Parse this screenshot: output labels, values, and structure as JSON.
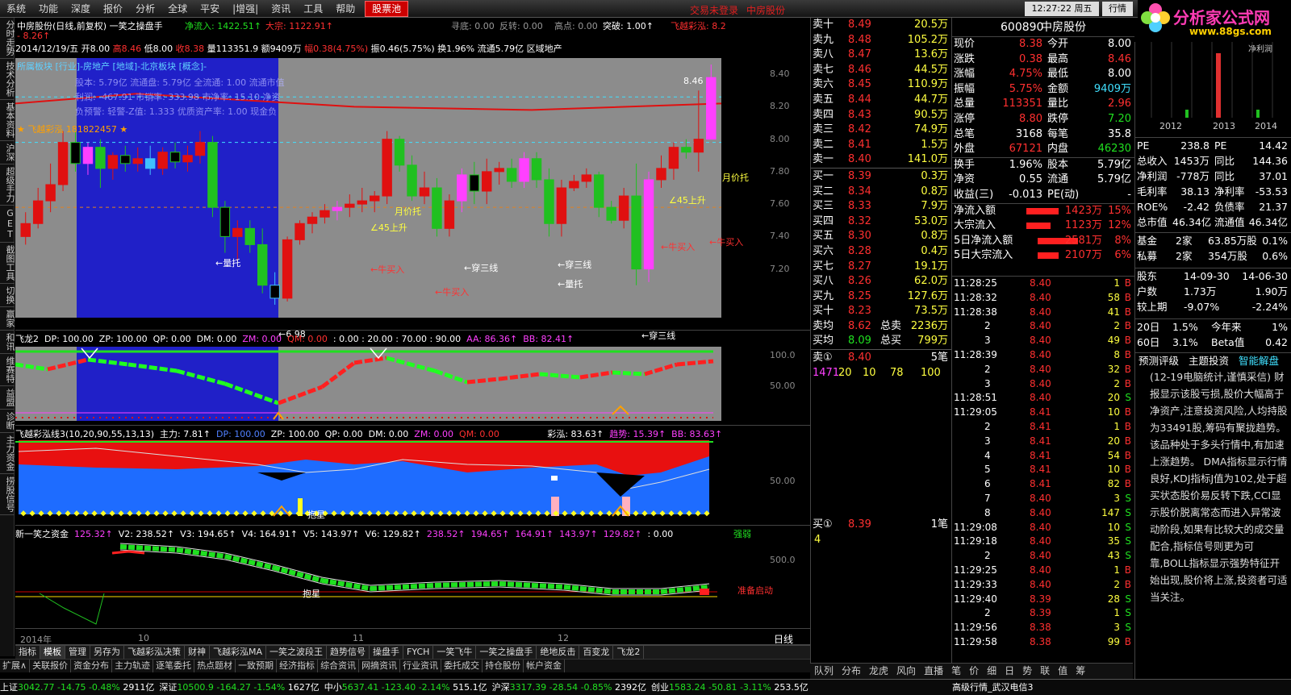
{
  "menu": {
    "items": [
      "系统",
      "功能",
      "深度",
      "报价",
      "分析",
      "全球",
      "平安",
      "|增强|",
      "资讯",
      "工具",
      "帮助"
    ],
    "highlight": "股票池",
    "login": "交易未登录",
    "stock_link": "中房股份",
    "time": "12:27:22 周五",
    "quote_btn": "行情"
  },
  "logo": {
    "text": "分析家公式网",
    "url": "www.88gs.com"
  },
  "vtabs": [
    "分时走势",
    "技术分析",
    "基本资料",
    "沪深",
    "超级手力",
    "GET",
    "截图工具",
    "切换",
    "赢家",
    "和讯",
    "维赛特",
    "益盟",
    "诊断",
    "主力资金",
    "捞股信号"
  ],
  "main": {
    "title": "中房股份(日线,前复权) 一笑之操盘手",
    "net_in": "净流入: 1422.51↑",
    "big": "大宗: 1122.91↑",
    "find_top": "寻底: 0.00",
    "reversal": "反转: 0.00",
    "high_pt": "高点: 0.00",
    "break": "突破: 1.00↑",
    "colorful": "飞越彩泓: 8.2",
    "line2_a": "2014/12/19/五",
    "open": "开8.00",
    "high": "高8.46",
    "low": "低8.00",
    "close": "收8.38",
    "vol": "量113351.9",
    "amt": "额9409万",
    "rng": "幅0.38(4.75%)",
    "amp": "振0.46(5.75%)",
    "turn": "换1.96%",
    "flow": "流通5.79亿",
    "region": "区域地产",
    "change": "- 8.26↑",
    "sector": "所属板块 [行业]-房地产 [地域]-北京板块 [概念]-",
    "info1": "股本: 5.79亿 流通盘: 5.79亿 全流通: 1.00 流通市值",
    "info2": "利润: -467.91 市销率: 333.98 市净率: 15.10 净资",
    "info3": "负预警: 轻警-Z值: 1.333 优质资产率: 1.00 现金负",
    "star": "★ 飞越彩泓 181822457 ★",
    "yticks": [
      "8.40",
      "8.20",
      "8.00",
      "7.80",
      "7.60",
      "7.40",
      "7.20"
    ],
    "labels": [
      "←量托",
      "←牛买入",
      "←牛买入",
      "←穿三线",
      "←量托",
      "←穿三线",
      "月价托",
      "∠45上升",
      "月价托",
      "∠45上升",
      "←牛买入",
      "←牛买入",
      "←穿三线",
      "8.46",
      "←6.98"
    ]
  },
  "p2": {
    "name": "飞龙2",
    "dp": "DP: 100.00",
    "zp": "ZP: 100.00",
    "qp": "QP: 0.00",
    "dm": "DM: 0.00",
    "zm": "ZM: 0.00",
    "qm": "QM: 0.00",
    "levels": ": 0.00 : 20.00 : 70.00 : 90.00",
    "aa": "AA: 86.36↑",
    "bb": "BB: 82.41↑",
    "yticks": [
      "100.0",
      "50.00"
    ]
  },
  "p3": {
    "name": "飞越彩泓线3(10,20,90,55,13,13)",
    "main": "主力: 7.81↑",
    "dp": "DP: 100.00",
    "zp": "ZP: 100.00",
    "qp": "QP: 0.00",
    "dm": "DM: 0.00",
    "zm": "ZM: 0.00",
    "qm": "QM: 0.00",
    "cai": "彩泓: 83.63↑",
    "trend": "趋势: 15.39↑",
    "bb": "BB: 83.63↑",
    "ytick": "50.00",
    "hold": "抱星"
  },
  "p4": {
    "name": "新一笑之资金",
    "v1": "125.32↑",
    "v2": "V2: 238.52↑",
    "v3": "V3: 194.65↑",
    "v4": "V4: 164.91↑",
    "v5": "V5: 143.97↑",
    "v6": "V6: 129.82↑",
    "r1": "238.52↑",
    "r2": "194.65↑",
    "r3": "164.91↑",
    "r4": "143.97↑",
    "r5": "129.82↑",
    "r6": ": 0.00",
    "strong": "强弱",
    "ytick": "500.0",
    "hold": "抱星",
    "ready": "准备启动"
  },
  "xaxis": [
    "2014年",
    "10",
    "11",
    "12"
  ],
  "btabs": [
    "指标",
    "模板",
    "管理",
    "另存为",
    "飞越彩泓决策",
    "财神",
    "飞越彩泓MA",
    "一笑之波段王",
    "趋势信号",
    "操盘手",
    "FYCH",
    "一笑飞牛",
    "一笑之操盘手",
    "绝地反击",
    "百变龙",
    "飞龙2"
  ],
  "btabs_active": "模板",
  "btabs2": [
    "扩展∧",
    "关联报价",
    "资金分布",
    "主力轨迹",
    "逐笔委托",
    "热点题材",
    "一致预期",
    "经济指标",
    "综合资讯",
    "网摘资讯",
    "行业资讯",
    "委托成交",
    "持仓股份",
    "帐户资金"
  ],
  "daytab": "日线",
  "book": {
    "sell": [
      [
        "卖十",
        "8.49",
        "20.5万"
      ],
      [
        "卖九",
        "8.48",
        "105.2万"
      ],
      [
        "卖八",
        "8.47",
        "13.6万"
      ],
      [
        "卖七",
        "8.46",
        "44.5万"
      ],
      [
        "卖六",
        "8.45",
        "110.9万"
      ],
      [
        "卖五",
        "8.44",
        "44.7万"
      ],
      [
        "卖四",
        "8.43",
        "90.5万"
      ],
      [
        "卖三",
        "8.42",
        "74.9万"
      ],
      [
        "卖二",
        "8.41",
        "1.5万"
      ],
      [
        "卖一",
        "8.40",
        "141.0万"
      ]
    ],
    "buy": [
      [
        "买一",
        "8.39",
        "0.3万"
      ],
      [
        "买二",
        "8.34",
        "0.8万"
      ],
      [
        "买三",
        "8.33",
        "7.9万"
      ],
      [
        "买四",
        "8.32",
        "53.0万"
      ],
      [
        "买五",
        "8.30",
        "0.8万"
      ],
      [
        "买六",
        "8.28",
        "0.4万"
      ],
      [
        "买七",
        "8.27",
        "19.1万"
      ],
      [
        "买八",
        "8.26",
        "62.0万"
      ],
      [
        "买九",
        "8.25",
        "127.6万"
      ],
      [
        "买十",
        "8.23",
        "73.5万"
      ]
    ],
    "avg_sell": [
      "卖均",
      "8.62",
      "总卖",
      "2236万"
    ],
    "avg_buy": [
      "买均",
      "8.09",
      "总买",
      "799万"
    ],
    "s1": [
      "卖①",
      "8.40",
      "5笔"
    ],
    "s1q": [
      "1471",
      "20",
      "10",
      "78",
      "100"
    ],
    "b1": [
      "买①",
      "8.39",
      "1笔"
    ],
    "b1q": "4"
  },
  "quote": {
    "code": "600890",
    "name": "中房股份",
    "rows": [
      [
        "现价",
        "8.38",
        "今开",
        "8.00"
      ],
      [
        "涨跌",
        "0.38",
        "最高",
        "8.46"
      ],
      [
        "涨幅",
        "4.75%",
        "最低",
        "8.00"
      ],
      [
        "振幅",
        "5.75%",
        "金额",
        "9409万"
      ],
      [
        "总量",
        "113351",
        "量比",
        "2.96"
      ],
      [
        "涨停",
        "8.80",
        "跌停",
        "7.20"
      ],
      [
        "总笔",
        "3168",
        "每笔",
        "35.8"
      ],
      [
        "外盘",
        "67121",
        "内盘",
        "46230"
      ],
      [
        "换手",
        "1.96%",
        "股本",
        "5.79亿"
      ],
      [
        "净资",
        "0.55",
        "流通",
        "5.79亿"
      ],
      [
        "收益(三)",
        "-0.013",
        "PE(动)",
        "-"
      ]
    ],
    "flows": [
      [
        "净流入额",
        "1423万",
        "15%"
      ],
      [
        "大宗流入",
        "1123万",
        "12%"
      ],
      [
        "5日净流入额",
        "2581万",
        "8%"
      ],
      [
        "5日大宗流入",
        "2107万",
        "6%"
      ]
    ]
  },
  "ticks": [
    [
      "11:28:25",
      "8.40",
      "1",
      "B"
    ],
    [
      "11:28:32",
      "8.40",
      "58",
      "B"
    ],
    [
      "11:28:38",
      "8.40",
      "41",
      "B"
    ],
    [
      "2",
      "8.40",
      "2",
      "B"
    ],
    [
      "3",
      "8.40",
      "49",
      "B"
    ],
    [
      "11:28:39",
      "8.40",
      "8",
      "B"
    ],
    [
      "2",
      "8.40",
      "32",
      "B"
    ],
    [
      "3",
      "8.40",
      "2",
      "B"
    ],
    [
      "11:28:51",
      "8.40",
      "20",
      "S"
    ],
    [
      "11:29:05",
      "8.41",
      "10",
      "B"
    ],
    [
      "2",
      "8.41",
      "1",
      "B"
    ],
    [
      "3",
      "8.41",
      "20",
      "B"
    ],
    [
      "4",
      "8.41",
      "54",
      "B"
    ],
    [
      "5",
      "8.41",
      "10",
      "B"
    ],
    [
      "6",
      "8.41",
      "82",
      "B"
    ],
    [
      "7",
      "8.40",
      "3",
      "S"
    ],
    [
      "8",
      "8.40",
      "147",
      "S"
    ],
    [
      "11:29:08",
      "8.40",
      "10",
      "S"
    ],
    [
      "11:29:18",
      "8.40",
      "35",
      "S"
    ],
    [
      "2",
      "8.40",
      "43",
      "S"
    ],
    [
      "11:29:25",
      "8.40",
      "1",
      "B"
    ],
    [
      "11:29:33",
      "8.40",
      "2",
      "B"
    ],
    [
      "11:29:40",
      "8.39",
      "28",
      "S"
    ],
    [
      "2",
      "8.39",
      "1",
      "S"
    ],
    [
      "11:29:56",
      "8.38",
      "3",
      "S"
    ],
    [
      "11:29:58",
      "8.38",
      "99",
      "B"
    ]
  ],
  "rtabs": [
    "队列",
    "分布",
    "龙虎",
    "风向",
    "直播",
    "笔",
    "价",
    "细",
    "日",
    "势",
    "联",
    "值",
    "筹"
  ],
  "fin": {
    "chart_label": "净利润",
    "years": [
      "2012",
      "2013",
      "2014"
    ],
    "rows": [
      [
        "PE",
        "238.8",
        "PE",
        "14.42"
      ],
      [
        "总收入",
        "1453万",
        "同比",
        "144.36"
      ],
      [
        "净利润",
        "-778万",
        "同比",
        "37.01"
      ],
      [
        "毛利率",
        "38.13",
        "净利率",
        "-53.53"
      ],
      [
        "ROE%",
        "-2.42",
        "负债率",
        "21.37"
      ],
      [
        "总市值",
        "46.34亿",
        "流通值",
        "46.34亿"
      ]
    ],
    "inst": [
      [
        "基金",
        "2家",
        "63.85万股",
        "0.1%"
      ],
      [
        "私募",
        "2家",
        "354万股",
        "0.6%"
      ]
    ],
    "holders": [
      [
        "股东",
        "14-09-30",
        "14-06-30"
      ],
      [
        "户数",
        "1.73万",
        "1.90万"
      ],
      [
        "较上期",
        "-9.07%",
        "-2.24%"
      ]
    ],
    "perf": [
      [
        "20日",
        "1.5%",
        "今年来",
        "1%"
      ],
      [
        "60日",
        "3.1%",
        "Beta值",
        "0.42"
      ]
    ],
    "tabs": [
      "预测评级",
      "主题投资",
      "智能解盘"
    ],
    "news": "(12-19电脑统计,谨慎采信) 财报显示该股亏损,股价大幅高于净资产,注意投资风险,人均持股为33491股,筹码有聚拢趋势。 该品种处于多头行情中,有加速上涨趋势。 DMA指标显示行情良好,KDJ指标J值为102,处于超买状态股价易反转下跌,CCI显示股价脱离常态而进入异常波动阶段,如果有比较大的成交量配合,指标信号则更为可靠,BOLL指标显示强势特征开始出现,股价将上涨,投资者可适当关注。"
  },
  "status": {
    "sh": [
      "上证",
      "3042.77",
      "-14.75",
      "-0.48%",
      "2911亿"
    ],
    "sz": [
      "深证",
      "10500.9",
      "-164.27",
      "-1.54%",
      "1627亿"
    ],
    "zx": [
      "中小",
      "5637.41",
      "-123.40",
      "-2.14%",
      "515.1亿"
    ],
    "hs": [
      "沪深",
      "3317.39",
      "-28.54",
      "-0.85%",
      "2392亿"
    ],
    "cy": [
      "创业",
      "1583.24",
      "-50.81",
      "-3.11%",
      "253.5亿"
    ],
    "server": "高级行情_武汉电信3"
  },
  "chart_data": {
    "type": "candlestick",
    "ylim": [
      6.9,
      8.5
    ],
    "candles": [
      [
        7.4,
        7.55,
        7.35,
        7.48
      ],
      [
        7.48,
        7.7,
        7.45,
        7.62
      ],
      [
        7.62,
        7.85,
        7.55,
        7.72
      ],
      [
        7.72,
        8.05,
        7.68,
        7.98
      ],
      [
        7.98,
        8.05,
        7.8,
        7.85
      ],
      [
        7.85,
        7.98,
        7.78,
        7.95
      ],
      [
        7.95,
        8.0,
        7.7,
        7.82
      ],
      [
        7.82,
        7.92,
        7.75,
        7.9
      ],
      [
        7.9,
        7.96,
        7.8,
        7.85
      ],
      [
        7.85,
        7.95,
        7.8,
        7.88
      ],
      [
        7.88,
        7.96,
        7.78,
        7.82
      ],
      [
        7.82,
        7.95,
        7.78,
        7.92
      ],
      [
        7.92,
        7.98,
        7.82,
        7.86
      ],
      [
        7.86,
        7.96,
        7.8,
        7.9
      ],
      [
        7.9,
        8.05,
        7.85,
        7.98
      ],
      [
        7.98,
        8.02,
        7.52,
        7.58
      ],
      [
        7.58,
        7.62,
        7.3,
        7.4
      ],
      [
        7.4,
        7.5,
        7.25,
        7.45
      ],
      [
        7.45,
        7.5,
        7.3,
        7.35
      ],
      [
        7.35,
        7.45,
        7.05,
        7.1
      ],
      [
        7.1,
        7.18,
        6.98,
        7.02
      ],
      [
        7.02,
        7.4,
        7.0,
        7.38
      ],
      [
        7.38,
        7.5,
        7.35,
        7.48
      ],
      [
        7.48,
        7.55,
        7.42,
        7.52
      ],
      [
        7.52,
        7.6,
        7.48,
        7.56
      ],
      [
        7.56,
        7.62,
        7.5,
        7.58
      ],
      [
        7.58,
        7.66,
        7.52,
        7.6
      ],
      [
        7.6,
        7.7,
        7.55,
        7.62
      ],
      [
        7.62,
        7.68,
        7.55,
        7.65
      ],
      [
        7.65,
        8.05,
        7.6,
        8.0
      ],
      [
        8.0,
        8.02,
        7.8,
        7.84
      ],
      [
        7.84,
        7.9,
        7.62,
        7.65
      ],
      [
        7.65,
        7.8,
        7.6,
        7.7
      ],
      [
        7.7,
        7.76,
        7.4,
        7.45
      ],
      [
        7.45,
        7.66,
        7.4,
        7.62
      ],
      [
        7.62,
        7.82,
        7.55,
        7.78
      ],
      [
        7.78,
        7.86,
        7.6,
        7.68
      ],
      [
        7.68,
        7.88,
        7.6,
        7.8
      ],
      [
        7.8,
        7.86,
        7.72,
        7.82
      ],
      [
        7.82,
        7.88,
        7.7,
        7.74
      ],
      [
        7.74,
        7.92,
        7.7,
        7.88
      ],
      [
        7.88,
        7.92,
        7.7,
        7.75
      ],
      [
        7.75,
        7.82,
        7.4,
        7.48
      ],
      [
        7.48,
        7.75,
        7.4,
        7.7
      ],
      [
        7.7,
        7.78,
        7.68,
        7.74
      ],
      [
        7.74,
        7.82,
        7.7,
        7.78
      ],
      [
        7.78,
        7.8,
        7.52,
        7.58
      ],
      [
        7.58,
        7.62,
        7.48,
        7.5
      ],
      [
        7.5,
        7.7,
        7.45,
        7.65
      ],
      [
        7.65,
        7.85,
        7.1,
        7.2
      ],
      [
        7.2,
        7.8,
        7.12,
        7.75
      ],
      [
        7.75,
        7.9,
        7.7,
        7.82
      ],
      [
        7.82,
        7.98,
        7.75,
        7.95
      ],
      [
        7.95,
        8.0,
        7.88,
        7.92
      ],
      [
        7.92,
        8.3,
        7.8,
        8.0
      ],
      [
        8.0,
        8.46,
        8.0,
        8.38
      ]
    ]
  }
}
